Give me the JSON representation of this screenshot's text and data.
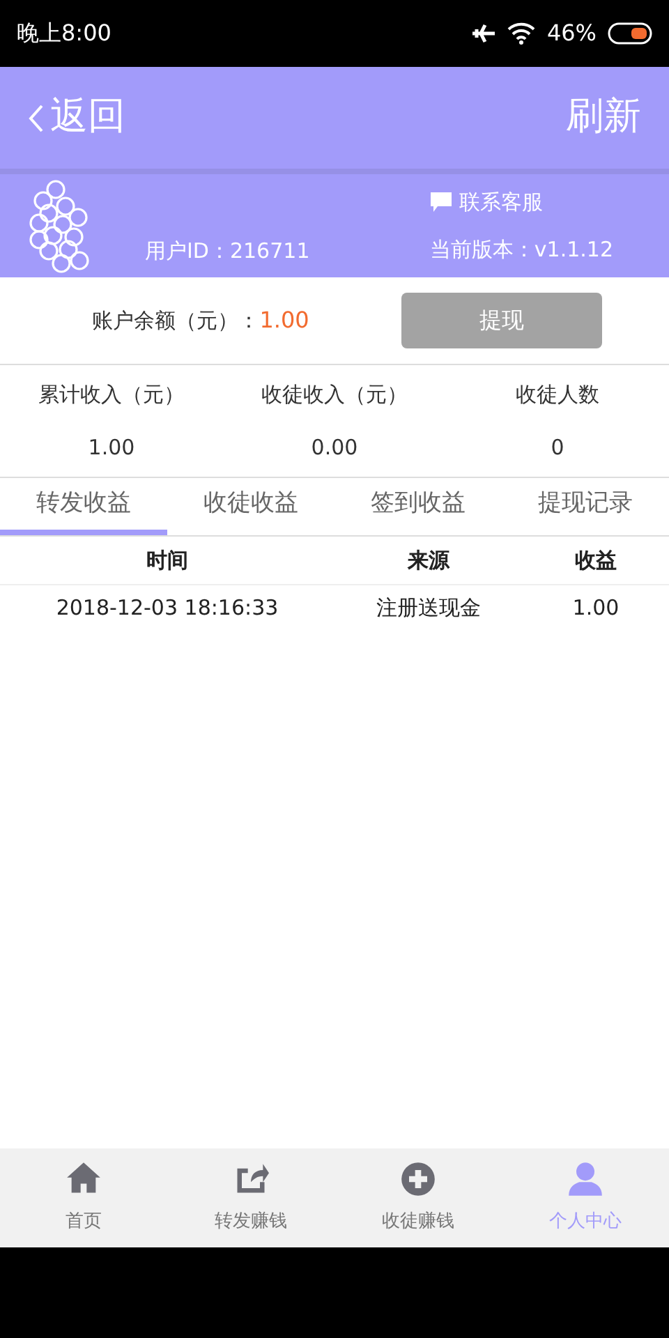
{
  "status_bar": {
    "time": "晚上8:00",
    "battery": "46%"
  },
  "header": {
    "back": "返回",
    "refresh": "刷新"
  },
  "profile": {
    "contact": "联系客服",
    "user_id": "用户ID：216711",
    "version": "当前版本：v1.1.12"
  },
  "balance": {
    "label": "账户余额（元）：",
    "value": "1.00",
    "button": "提现"
  },
  "stats": [
    {
      "label": "累计收入（元）",
      "value": "1.00"
    },
    {
      "label": "收徒收入（元）",
      "value": "0.00"
    },
    {
      "label": "收徒人数",
      "value": "0"
    }
  ],
  "tabs": [
    {
      "label": "转发收益",
      "selected": true
    },
    {
      "label": "收徒收益",
      "selected": false
    },
    {
      "label": "签到收益",
      "selected": false
    },
    {
      "label": "提现记录",
      "selected": false
    }
  ],
  "table": {
    "columns": [
      "时间",
      "来源",
      "收益"
    ],
    "rows": [
      [
        "2018-12-03 18:16:33",
        "注册送现金",
        "1.00"
      ]
    ]
  },
  "bottom_nav": [
    {
      "kind": "home",
      "label": "首页",
      "selected": false
    },
    {
      "kind": "share",
      "label": "转发赚钱",
      "selected": false
    },
    {
      "kind": "plus",
      "label": "收徒赚钱",
      "selected": false
    },
    {
      "kind": "user",
      "label": "个人中心",
      "selected": true
    }
  ]
}
